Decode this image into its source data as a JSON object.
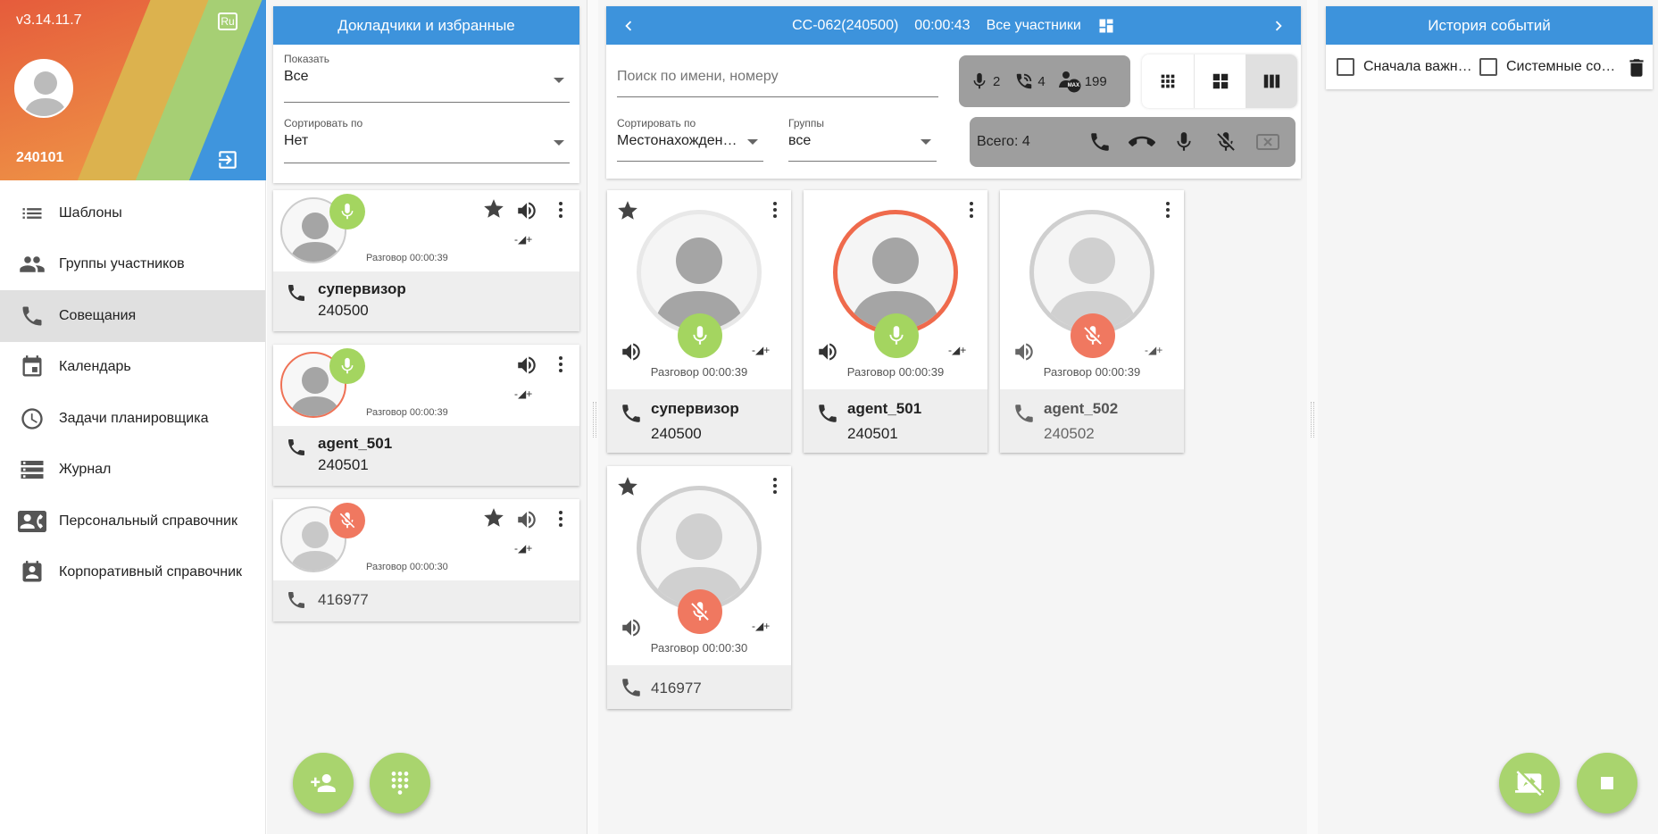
{
  "app": {
    "version": "v3.14.11.7",
    "lang": "Ru",
    "user_id": "240101"
  },
  "sidebar": {
    "items": [
      {
        "label": "Шаблоны",
        "icon": "list-icon"
      },
      {
        "label": "Группы участников",
        "icon": "people-icon"
      },
      {
        "label": "Совещания",
        "icon": "phone-icon",
        "active": true
      },
      {
        "label": "Календарь",
        "icon": "calendar-icon"
      },
      {
        "label": "Задачи планировщика",
        "icon": "clock-icon"
      },
      {
        "label": "Журнал",
        "icon": "storage-icon"
      },
      {
        "label": "Персональный справочник",
        "icon": "contact-phone-icon"
      },
      {
        "label": "Корпоративный справочник",
        "icon": "contact-icon"
      }
    ]
  },
  "favorites": {
    "title": "Докладчики и избранные",
    "show": {
      "label": "Показать",
      "value": "Все"
    },
    "sort": {
      "label": "Сортировать по",
      "value": "Нет"
    },
    "cards": [
      {
        "name": "супервизор",
        "number": "240500",
        "time": "Разговор 00:00:39",
        "mic": "on",
        "starred": true
      },
      {
        "name": "agent_501",
        "number": "240501",
        "time": "Разговор 00:00:39",
        "mic": "on",
        "starred": false
      },
      {
        "name": "",
        "number": "416977",
        "time": "Разговор 00:00:30",
        "mic": "off",
        "starred": true
      }
    ]
  },
  "conference": {
    "title": "CC-062(240500)",
    "timer": "00:00:43",
    "filter": "Все участники",
    "search_placeholder": "Поиск по имени, номеру",
    "stats": {
      "speakers": "2",
      "calls": "4",
      "max": "199"
    },
    "max_badge": "MAX",
    "sort": {
      "label": "Сортировать по",
      "value": "Местонахожден…"
    },
    "groups": {
      "label": "Группы",
      "value": "все"
    },
    "total": "Всего: 4",
    "participants": [
      {
        "name": "супервизор",
        "number": "240500",
        "time": "Разговор 00:00:39",
        "mic": "on",
        "speaking": false
      },
      {
        "name": "agent_501",
        "number": "240501",
        "time": "Разговор 00:00:39",
        "mic": "on",
        "speaking": true
      },
      {
        "name": "agent_502",
        "number": "240502",
        "time": "Разговор 00:00:39",
        "mic": "off",
        "speaking": false
      },
      {
        "name": "",
        "number": "416977",
        "time": "Разговор 00:00:30",
        "mic": "off",
        "speaking": false
      }
    ]
  },
  "history": {
    "title": "История событий",
    "important_first": "Сначала важн…",
    "system": "Системные со…"
  },
  "colors": {
    "header": "#3d93dc",
    "mic_on": "#a4d560",
    "mic_off": "#f07860",
    "fab": "#a9d46e"
  }
}
